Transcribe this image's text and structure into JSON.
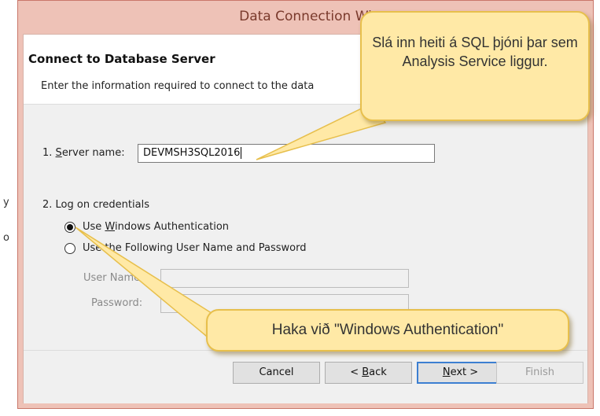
{
  "window": {
    "title": "Data Connection Wi"
  },
  "page": {
    "title": "Connect to Database Server",
    "description": "Enter the information required to connect to the data"
  },
  "server": {
    "label_prefix": "1. ",
    "label_mnemonic": "S",
    "label_rest": "erver name:",
    "value": "DEVMSH3SQL2016"
  },
  "credentials": {
    "label": "2. Log on credentials",
    "options": [
      {
        "pre": "Use ",
        "mnemonic": "W",
        "post": "indows Authentication",
        "selected": true
      },
      {
        "pre": "Use ",
        "mnemonic": "t",
        "post": "he Following User Name and Password",
        "selected": false
      }
    ],
    "user_name_label": "User Name:",
    "password_label": "Password:"
  },
  "buttons": {
    "cancel": "Cancel",
    "back_prefix": "< ",
    "back_mnemonic": "B",
    "back_rest": "ack",
    "next_mnemonic": "N",
    "next_rest": "ext >",
    "finish": "Finish"
  },
  "callouts": {
    "server_hint": "Slá inn heiti á SQL þjóni þar sem Analysis Service liggur.",
    "auth_hint": "Haka við \"Windows Authentication\""
  },
  "colors": {
    "title_bar": "#eec2b7",
    "callout_fill": "#ffe9a6",
    "callout_border": "#e7bf4c",
    "default_button_border": "#3c7fd1"
  },
  "edge_text": [
    "y",
    "o"
  ]
}
